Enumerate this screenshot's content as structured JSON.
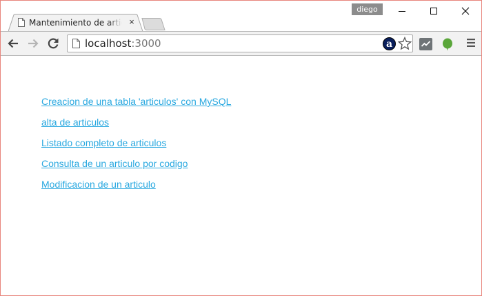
{
  "browser": {
    "tab": {
      "title": "Mantenimiento de articulos",
      "close_glyph": "×"
    },
    "profile_name": "diego",
    "address": {
      "host": "localhost",
      "port": ":3000"
    },
    "icons": {
      "favicon": "page-icon",
      "new_tab": "new-tab-icon",
      "minimize": "minimize-icon",
      "maximize": "maximize-icon",
      "close": "close-icon",
      "back": "back-arrow-icon",
      "forward": "forward-arrow-icon",
      "reload": "reload-icon",
      "page_info": "page-info-icon",
      "amazon_extension": "amazon-a-icon",
      "bookmark": "star-icon",
      "extension_chart": "chart-extension-icon",
      "extension_evernote": "evernote-icon",
      "menu": "hamburger-menu-icon"
    },
    "amazon_glyph": "a"
  },
  "page": {
    "links": [
      {
        "label": "Creacion de una tabla 'articulos' con MySQL"
      },
      {
        "label": "alta de articulos"
      },
      {
        "label": "Listado completo de articulos"
      },
      {
        "label": "Consulta de un articulo por codigo"
      },
      {
        "label": "Modificacion de un articulo"
      }
    ],
    "link_color": "#29a8e0"
  },
  "colors": {
    "window_border": "#e8847c",
    "toolbar_bg": "#f2f2f2",
    "profile_badge": "#8c8c8c"
  }
}
